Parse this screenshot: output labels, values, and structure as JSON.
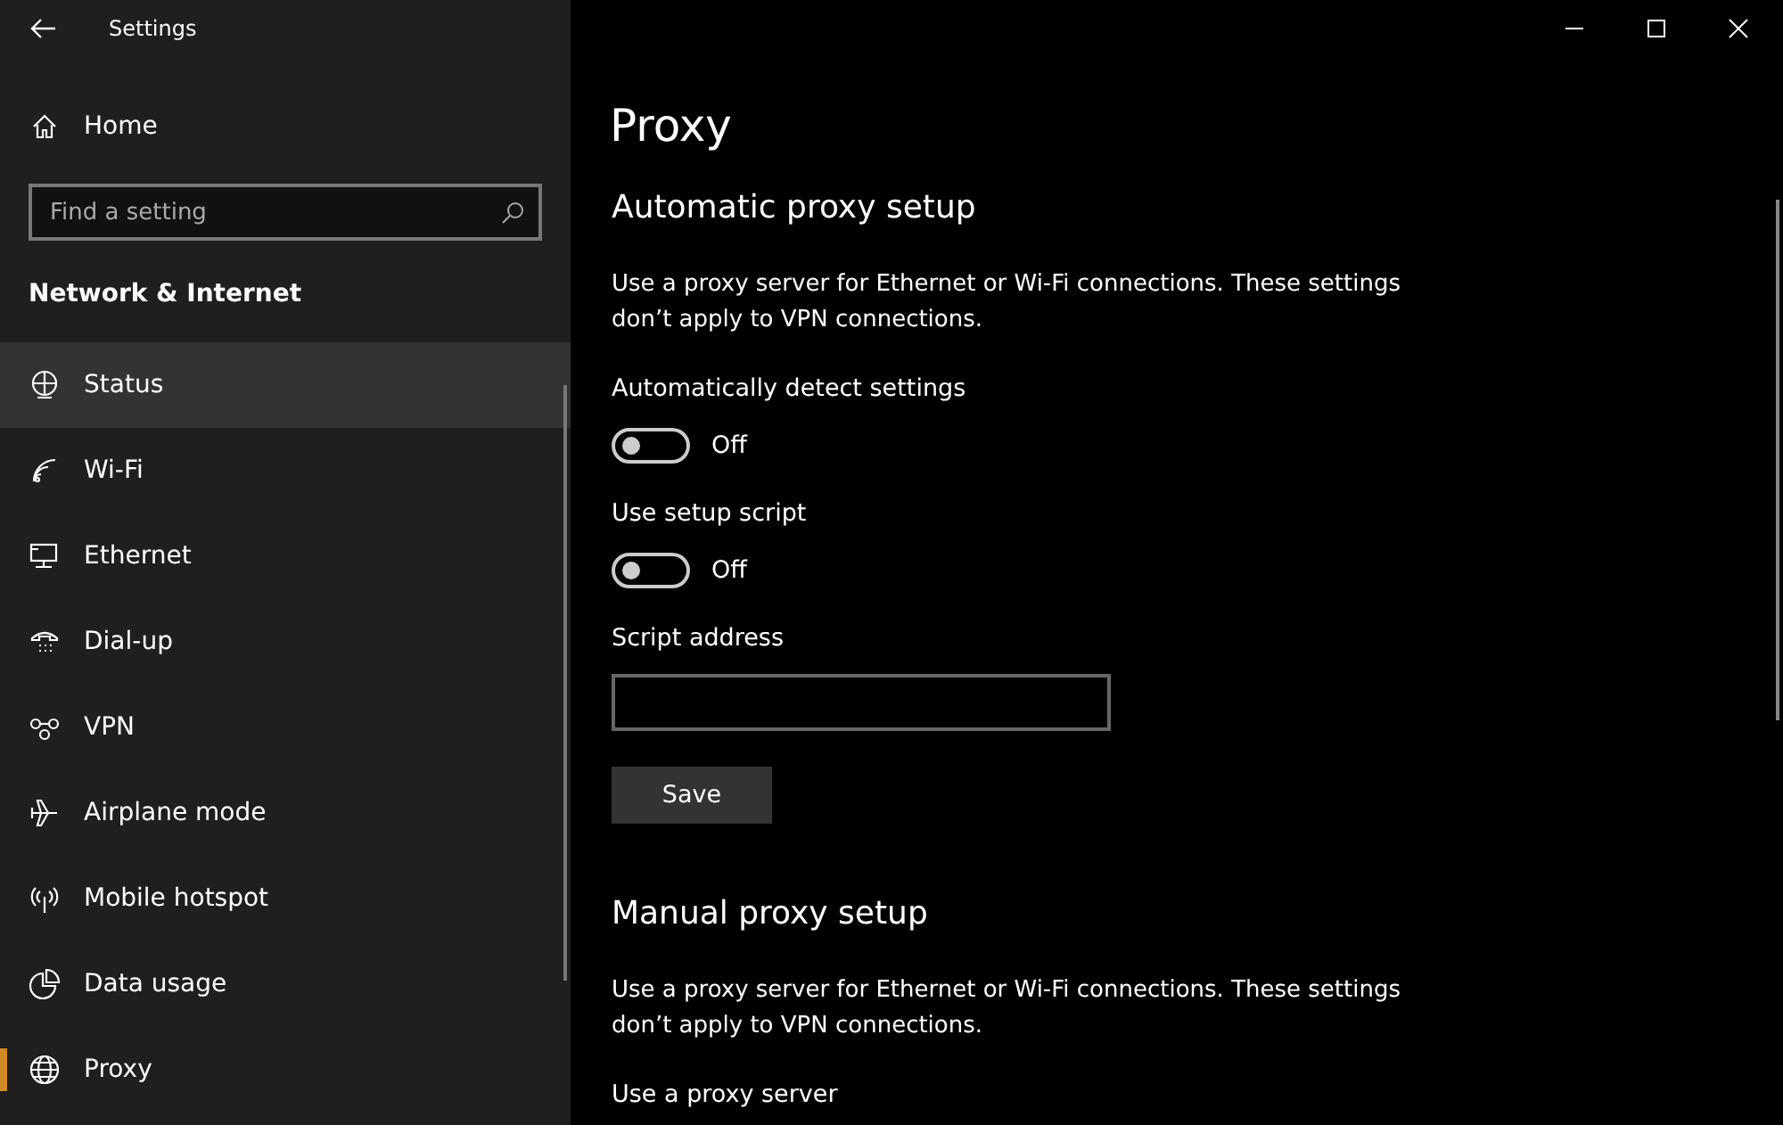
{
  "window": {
    "title": "Settings"
  },
  "sidebar": {
    "home": "Home",
    "search": {
      "placeholder": "Find a setting"
    },
    "section": "Network & Internet",
    "items": [
      {
        "label": "Status",
        "selected": false,
        "highlighted": true
      },
      {
        "label": "Wi-Fi",
        "selected": false,
        "highlighted": false
      },
      {
        "label": "Ethernet",
        "selected": false,
        "highlighted": false
      },
      {
        "label": "Dial-up",
        "selected": false,
        "highlighted": false
      },
      {
        "label": "VPN",
        "selected": false,
        "highlighted": false
      },
      {
        "label": "Airplane mode",
        "selected": false,
        "highlighted": false
      },
      {
        "label": "Mobile hotspot",
        "selected": false,
        "highlighted": false
      },
      {
        "label": "Data usage",
        "selected": false,
        "highlighted": false
      },
      {
        "label": "Proxy",
        "selected": true,
        "highlighted": false
      }
    ]
  },
  "page": {
    "title": "Proxy",
    "sections": [
      {
        "heading": "Automatic proxy setup",
        "description": "Use a proxy server for Ethernet or Wi-Fi connections. These settings don’t apply to VPN connections.",
        "controls": [
          {
            "kind": "toggle",
            "label": "Automatically detect settings",
            "on": false,
            "state": "Off"
          },
          {
            "kind": "toggle",
            "label": "Use setup script",
            "on": false,
            "state": "Off"
          },
          {
            "kind": "field",
            "label": "Script address"
          },
          {
            "kind": "button",
            "label": "Save"
          }
        ]
      },
      {
        "heading": "Manual proxy setup",
        "description": "Use a proxy server for Ethernet or Wi-Fi connections. These settings don’t apply to VPN connections.",
        "controls": [
          {
            "kind": "label",
            "label": "Use a proxy server"
          }
        ]
      }
    ]
  }
}
